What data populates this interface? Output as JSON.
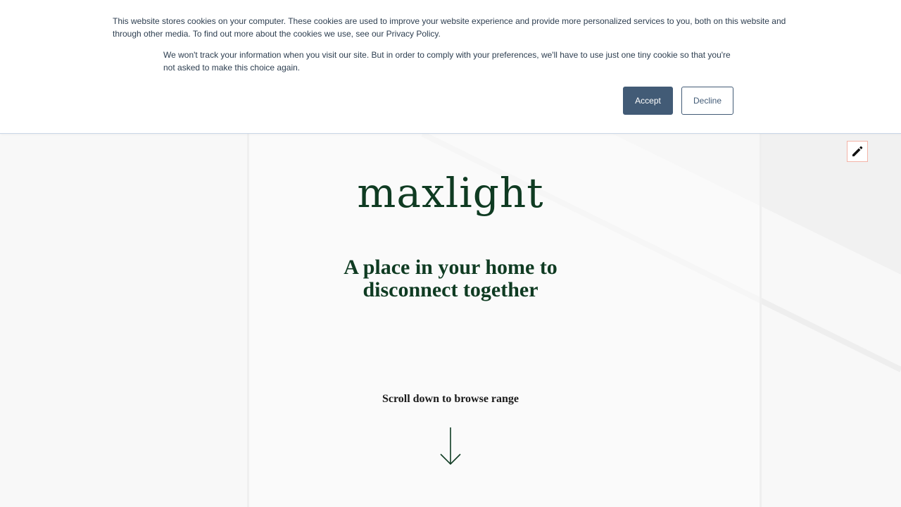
{
  "cookie_banner": {
    "message": "This website stores cookies on your computer. These cookies are used to improve your website experience and provide more personalized services to you, both on this website and through other media. To find out more about the cookies we use, see our Privacy Policy.",
    "decline_notice": "We won't track your information when you visit our site. But in order to comply with your preferences, we'll have to use just one tiny cookie so that you're not asked to make this choice again.",
    "accept_label": "Accept",
    "decline_label": "Decline"
  },
  "edit": {
    "icon": "pencil-icon"
  },
  "hero": {
    "logo_text": "maxlight",
    "tagline": "A place in your home to disconnect together",
    "scroll_hint": "Scroll down to browse range",
    "scroll_icon": "arrow-down-icon"
  },
  "colors": {
    "brand_green": "#0f3b22",
    "button_blue": "#425b76",
    "banner_text": "#2d3e50",
    "background": "#f8f8f8"
  }
}
